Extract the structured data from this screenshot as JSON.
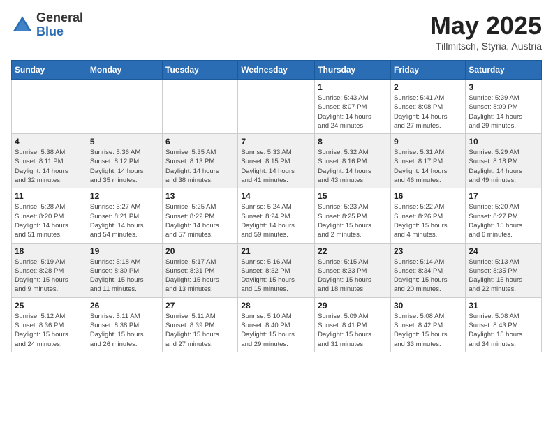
{
  "header": {
    "logo_general": "General",
    "logo_blue": "Blue",
    "month_title": "May 2025",
    "location": "Tillmitsch, Styria, Austria"
  },
  "weekdays": [
    "Sunday",
    "Monday",
    "Tuesday",
    "Wednesday",
    "Thursday",
    "Friday",
    "Saturday"
  ],
  "weeks": [
    [
      {
        "day": "",
        "info": ""
      },
      {
        "day": "",
        "info": ""
      },
      {
        "day": "",
        "info": ""
      },
      {
        "day": "",
        "info": ""
      },
      {
        "day": "1",
        "info": "Sunrise: 5:43 AM\nSunset: 8:07 PM\nDaylight: 14 hours\nand 24 minutes."
      },
      {
        "day": "2",
        "info": "Sunrise: 5:41 AM\nSunset: 8:08 PM\nDaylight: 14 hours\nand 27 minutes."
      },
      {
        "day": "3",
        "info": "Sunrise: 5:39 AM\nSunset: 8:09 PM\nDaylight: 14 hours\nand 29 minutes."
      }
    ],
    [
      {
        "day": "4",
        "info": "Sunrise: 5:38 AM\nSunset: 8:11 PM\nDaylight: 14 hours\nand 32 minutes."
      },
      {
        "day": "5",
        "info": "Sunrise: 5:36 AM\nSunset: 8:12 PM\nDaylight: 14 hours\nand 35 minutes."
      },
      {
        "day": "6",
        "info": "Sunrise: 5:35 AM\nSunset: 8:13 PM\nDaylight: 14 hours\nand 38 minutes."
      },
      {
        "day": "7",
        "info": "Sunrise: 5:33 AM\nSunset: 8:15 PM\nDaylight: 14 hours\nand 41 minutes."
      },
      {
        "day": "8",
        "info": "Sunrise: 5:32 AM\nSunset: 8:16 PM\nDaylight: 14 hours\nand 43 minutes."
      },
      {
        "day": "9",
        "info": "Sunrise: 5:31 AM\nSunset: 8:17 PM\nDaylight: 14 hours\nand 46 minutes."
      },
      {
        "day": "10",
        "info": "Sunrise: 5:29 AM\nSunset: 8:18 PM\nDaylight: 14 hours\nand 49 minutes."
      }
    ],
    [
      {
        "day": "11",
        "info": "Sunrise: 5:28 AM\nSunset: 8:20 PM\nDaylight: 14 hours\nand 51 minutes."
      },
      {
        "day": "12",
        "info": "Sunrise: 5:27 AM\nSunset: 8:21 PM\nDaylight: 14 hours\nand 54 minutes."
      },
      {
        "day": "13",
        "info": "Sunrise: 5:25 AM\nSunset: 8:22 PM\nDaylight: 14 hours\nand 57 minutes."
      },
      {
        "day": "14",
        "info": "Sunrise: 5:24 AM\nSunset: 8:24 PM\nDaylight: 14 hours\nand 59 minutes."
      },
      {
        "day": "15",
        "info": "Sunrise: 5:23 AM\nSunset: 8:25 PM\nDaylight: 15 hours\nand 2 minutes."
      },
      {
        "day": "16",
        "info": "Sunrise: 5:22 AM\nSunset: 8:26 PM\nDaylight: 15 hours\nand 4 minutes."
      },
      {
        "day": "17",
        "info": "Sunrise: 5:20 AM\nSunset: 8:27 PM\nDaylight: 15 hours\nand 6 minutes."
      }
    ],
    [
      {
        "day": "18",
        "info": "Sunrise: 5:19 AM\nSunset: 8:28 PM\nDaylight: 15 hours\nand 9 minutes."
      },
      {
        "day": "19",
        "info": "Sunrise: 5:18 AM\nSunset: 8:30 PM\nDaylight: 15 hours\nand 11 minutes."
      },
      {
        "day": "20",
        "info": "Sunrise: 5:17 AM\nSunset: 8:31 PM\nDaylight: 15 hours\nand 13 minutes."
      },
      {
        "day": "21",
        "info": "Sunrise: 5:16 AM\nSunset: 8:32 PM\nDaylight: 15 hours\nand 15 minutes."
      },
      {
        "day": "22",
        "info": "Sunrise: 5:15 AM\nSunset: 8:33 PM\nDaylight: 15 hours\nand 18 minutes."
      },
      {
        "day": "23",
        "info": "Sunrise: 5:14 AM\nSunset: 8:34 PM\nDaylight: 15 hours\nand 20 minutes."
      },
      {
        "day": "24",
        "info": "Sunrise: 5:13 AM\nSunset: 8:35 PM\nDaylight: 15 hours\nand 22 minutes."
      }
    ],
    [
      {
        "day": "25",
        "info": "Sunrise: 5:12 AM\nSunset: 8:36 PM\nDaylight: 15 hours\nand 24 minutes."
      },
      {
        "day": "26",
        "info": "Sunrise: 5:11 AM\nSunset: 8:38 PM\nDaylight: 15 hours\nand 26 minutes."
      },
      {
        "day": "27",
        "info": "Sunrise: 5:11 AM\nSunset: 8:39 PM\nDaylight: 15 hours\nand 27 minutes."
      },
      {
        "day": "28",
        "info": "Sunrise: 5:10 AM\nSunset: 8:40 PM\nDaylight: 15 hours\nand 29 minutes."
      },
      {
        "day": "29",
        "info": "Sunrise: 5:09 AM\nSunset: 8:41 PM\nDaylight: 15 hours\nand 31 minutes."
      },
      {
        "day": "30",
        "info": "Sunrise: 5:08 AM\nSunset: 8:42 PM\nDaylight: 15 hours\nand 33 minutes."
      },
      {
        "day": "31",
        "info": "Sunrise: 5:08 AM\nSunset: 8:43 PM\nDaylight: 15 hours\nand 34 minutes."
      }
    ]
  ]
}
